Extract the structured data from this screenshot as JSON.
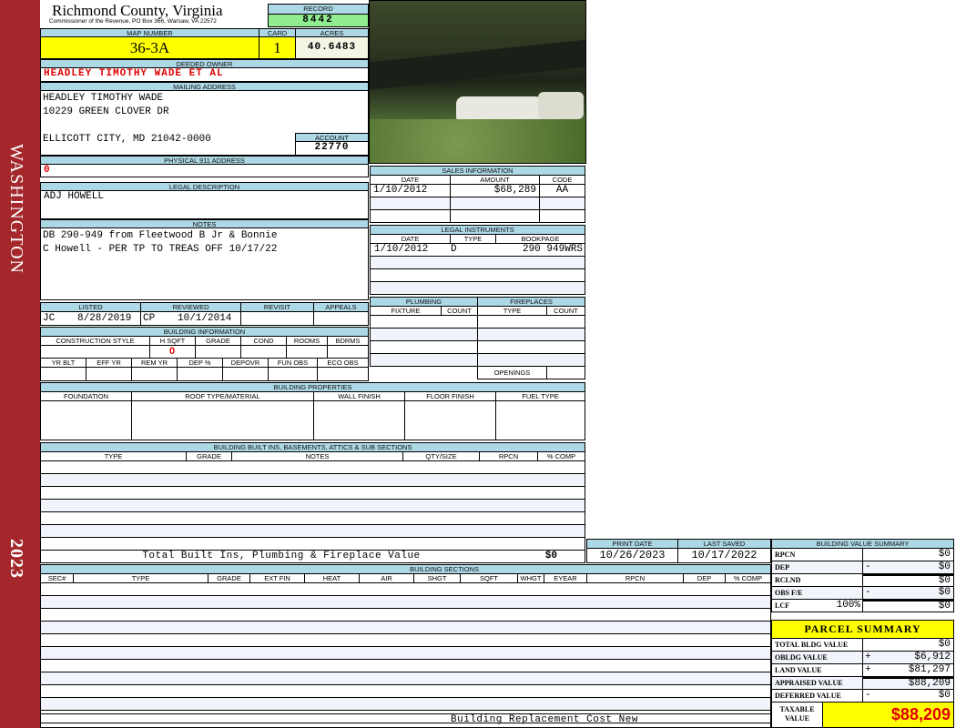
{
  "sidebar": {
    "district": "WASHINGTON",
    "year": "2023"
  },
  "header": {
    "title": "Richmond County, Virginia",
    "subtitle": "Commissioner of the Revenue, PO Box 366, Warsaw, VA 22572"
  },
  "record": {
    "label": "RECORD",
    "value": "8442"
  },
  "map": {
    "label": "MAP NUMBER",
    "value": "36-3A",
    "card_label": "CARD",
    "card": "1",
    "acres_label": "ACRES",
    "acres": "40.6483"
  },
  "owner": {
    "label": "DEEDED OWNER",
    "value": "HEADLEY TIMOTHY WADE ET AL"
  },
  "mailing": {
    "label": "MAILING ADDRESS",
    "lines": [
      "HEADLEY TIMOTHY WADE",
      "10229 GREEN CLOVER DR",
      "",
      "ELLICOTT CITY, MD 21042-0000"
    ],
    "account_label": "ACCOUNT",
    "account": "22770"
  },
  "physical": {
    "label": "PHYSICAL 911 ADDRESS",
    "value": "0"
  },
  "legal": {
    "label": "LEGAL DESCRIPTION",
    "value": "ADJ HOWELL"
  },
  "notes": {
    "label": "NOTES",
    "lines": [
      "DB 290-949 from Fleetwood B Jr & Bonnie",
      "C Howell - PER TP TO TREAS OFF 10/17/22"
    ]
  },
  "review": {
    "columns": [
      "LISTED",
      "REVIEWED",
      "REVISIT",
      "APPEALS"
    ],
    "listed_by": "JC",
    "listed_date": "8/28/2019",
    "reviewed_by": "CP",
    "reviewed_date": "10/1/2014"
  },
  "building_info": {
    "title": "BUILDING INFORMATION",
    "columns1": [
      "CONSTRUCTION STYLE",
      "H SQFT",
      "GRADE",
      "COND",
      "ROOMS",
      "BDRMS"
    ],
    "hsqft": "0",
    "columns2": [
      "YR BLT",
      "EFF YR",
      "REM YR",
      "DEP %",
      "DEPOVR",
      "FUN OBS",
      "ECO OBS"
    ]
  },
  "sales": {
    "title": "SALES INFORMATION",
    "columns": [
      "DATE",
      "AMOUNT",
      "CODE"
    ],
    "rows": [
      [
        "1/10/2012",
        "$68,289",
        "AA"
      ]
    ]
  },
  "instruments": {
    "title": "LEGAL INSTRUMENTS",
    "columns": [
      "DATE",
      "TYPE",
      "BOOKPAGE"
    ],
    "rows": [
      [
        "1/10/2012",
        "D",
        "290 949WRS"
      ]
    ]
  },
  "plumbing": {
    "title": "PLUMBING",
    "columns": [
      "FIXTURE",
      "COUNT"
    ]
  },
  "fireplaces": {
    "title": "FIREPLACES",
    "columns": [
      "TYPE",
      "COUNT"
    ],
    "openings": "OPENINGS"
  },
  "properties": {
    "title": "BUILDING PROPERTIES",
    "columns": [
      "FOUNDATION",
      "ROOF TYPE/MATERIAL",
      "WALL FINISH",
      "FLOOR FINISH",
      "FUEL TYPE"
    ]
  },
  "builtins": {
    "title": "BUILDING BUILT INS, BASEMENTS, ATTICS & SUB SECTIONS",
    "columns": [
      "TYPE",
      "GRADE",
      "NOTES",
      "QTY/SIZE",
      "RPCN",
      "% COMP"
    ],
    "total_label": "Total Built Ins, Plumbing & Fireplace Value",
    "total": "$0"
  },
  "dates": {
    "print_label": "PRINT DATE",
    "print": "10/26/2023",
    "saved_label": "LAST SAVED",
    "saved": "10/17/2022"
  },
  "sections": {
    "title": "BUILDING SECTIONS",
    "columns": [
      "SEC#",
      "TYPE",
      "GRADE",
      "EXT FIN",
      "HEAT",
      "AIR",
      "SHGT",
      "SQFT",
      "WHGT",
      "EYEAR",
      "RPCN",
      "DEP",
      "% COMP"
    ],
    "footer": "Building Replacement Cost New"
  },
  "value_summary": {
    "title": "BUILDING VALUE SUMMARY",
    "rows": [
      {
        "label": "RPCN",
        "op": "",
        "value": "$0"
      },
      {
        "label": "DEP",
        "op": "-",
        "value": "$0"
      },
      {
        "label": "RCLND",
        "op": "",
        "value": "$0"
      },
      {
        "label": "OBS F/E",
        "op": "-",
        "value": "$0"
      },
      {
        "label": "LCF",
        "pct": "100%",
        "op": "",
        "value": "$0"
      }
    ]
  },
  "parcel": {
    "title": "PARCEL SUMMARY",
    "rows": [
      {
        "label": "TOTAL BLDG VALUE",
        "op": "",
        "value": "$0"
      },
      {
        "label": "OBLDG VALUE",
        "op": "+",
        "value": "$6,912"
      },
      {
        "label": "LAND VALUE",
        "op": "+",
        "value": "$81,297"
      },
      {
        "label": "APPRAISED VALUE",
        "op": "",
        "value": "$88,209"
      },
      {
        "label": "DEFERRED VALUE",
        "op": "-",
        "value": "$0"
      }
    ],
    "taxable_label": "TAXABLE VALUE",
    "taxable": "$88,209"
  },
  "colors": {
    "sidebar": "#a3272b",
    "header": "#add8e6",
    "highlight": "#ffff00",
    "record": "#90ee90",
    "alert": "#e00000"
  }
}
